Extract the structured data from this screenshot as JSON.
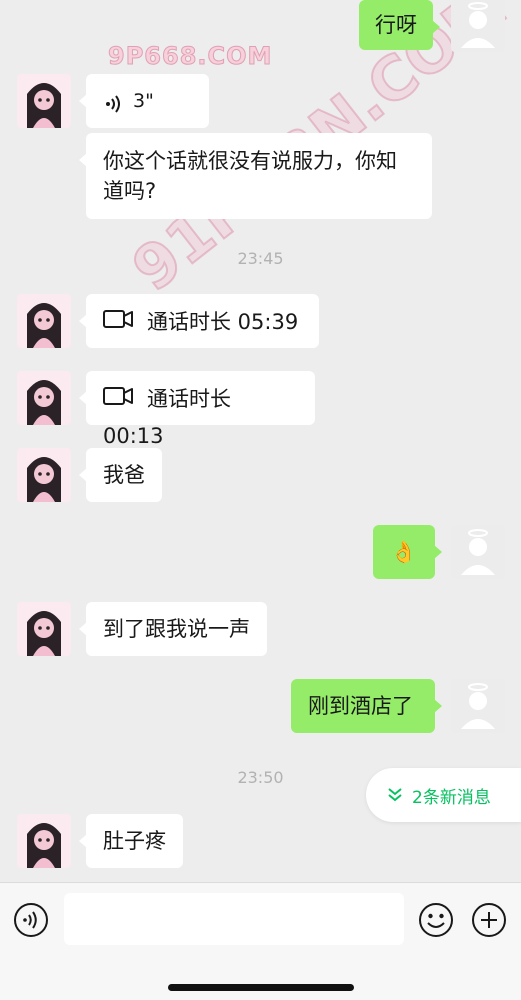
{
  "watermarks": {
    "top": "9P668.COM",
    "diagonal": "91PORN.COM"
  },
  "messages": [
    {
      "side": "right",
      "type": "text",
      "text": "行呀"
    },
    {
      "side": "left",
      "type": "voice",
      "duration": "3\""
    },
    {
      "side": "left",
      "type": "text",
      "text": "你这个话就很没有说服力，你知道吗?"
    },
    {
      "type": "timestamp",
      "text": "23:45"
    },
    {
      "side": "left",
      "type": "video_call",
      "text": "通话时长 05:39"
    },
    {
      "side": "left",
      "type": "video_call",
      "text": "通话时长 00:13"
    },
    {
      "side": "left",
      "type": "text",
      "text": "我爸"
    },
    {
      "side": "right",
      "type": "emoji",
      "text": "👌"
    },
    {
      "side": "left",
      "type": "text",
      "text": "到了跟我说一声"
    },
    {
      "side": "right",
      "type": "text",
      "text": "刚到酒店了"
    },
    {
      "type": "timestamp",
      "text": "23:50"
    },
    {
      "side": "left",
      "type": "text",
      "text": "肚子疼"
    }
  ],
  "new_messages": {
    "label": "2条新消息",
    "icon": "double-chevron-down-icon"
  },
  "input_bar": {
    "voice_icon": "voice-input-icon",
    "text_value": "",
    "emoji_icon": "emoji-icon",
    "plus_icon": "plus-icon"
  },
  "colors": {
    "background": "#ededed",
    "bubble_self": "#95ec69",
    "bubble_other": "#ffffff",
    "accent": "#07c160"
  }
}
